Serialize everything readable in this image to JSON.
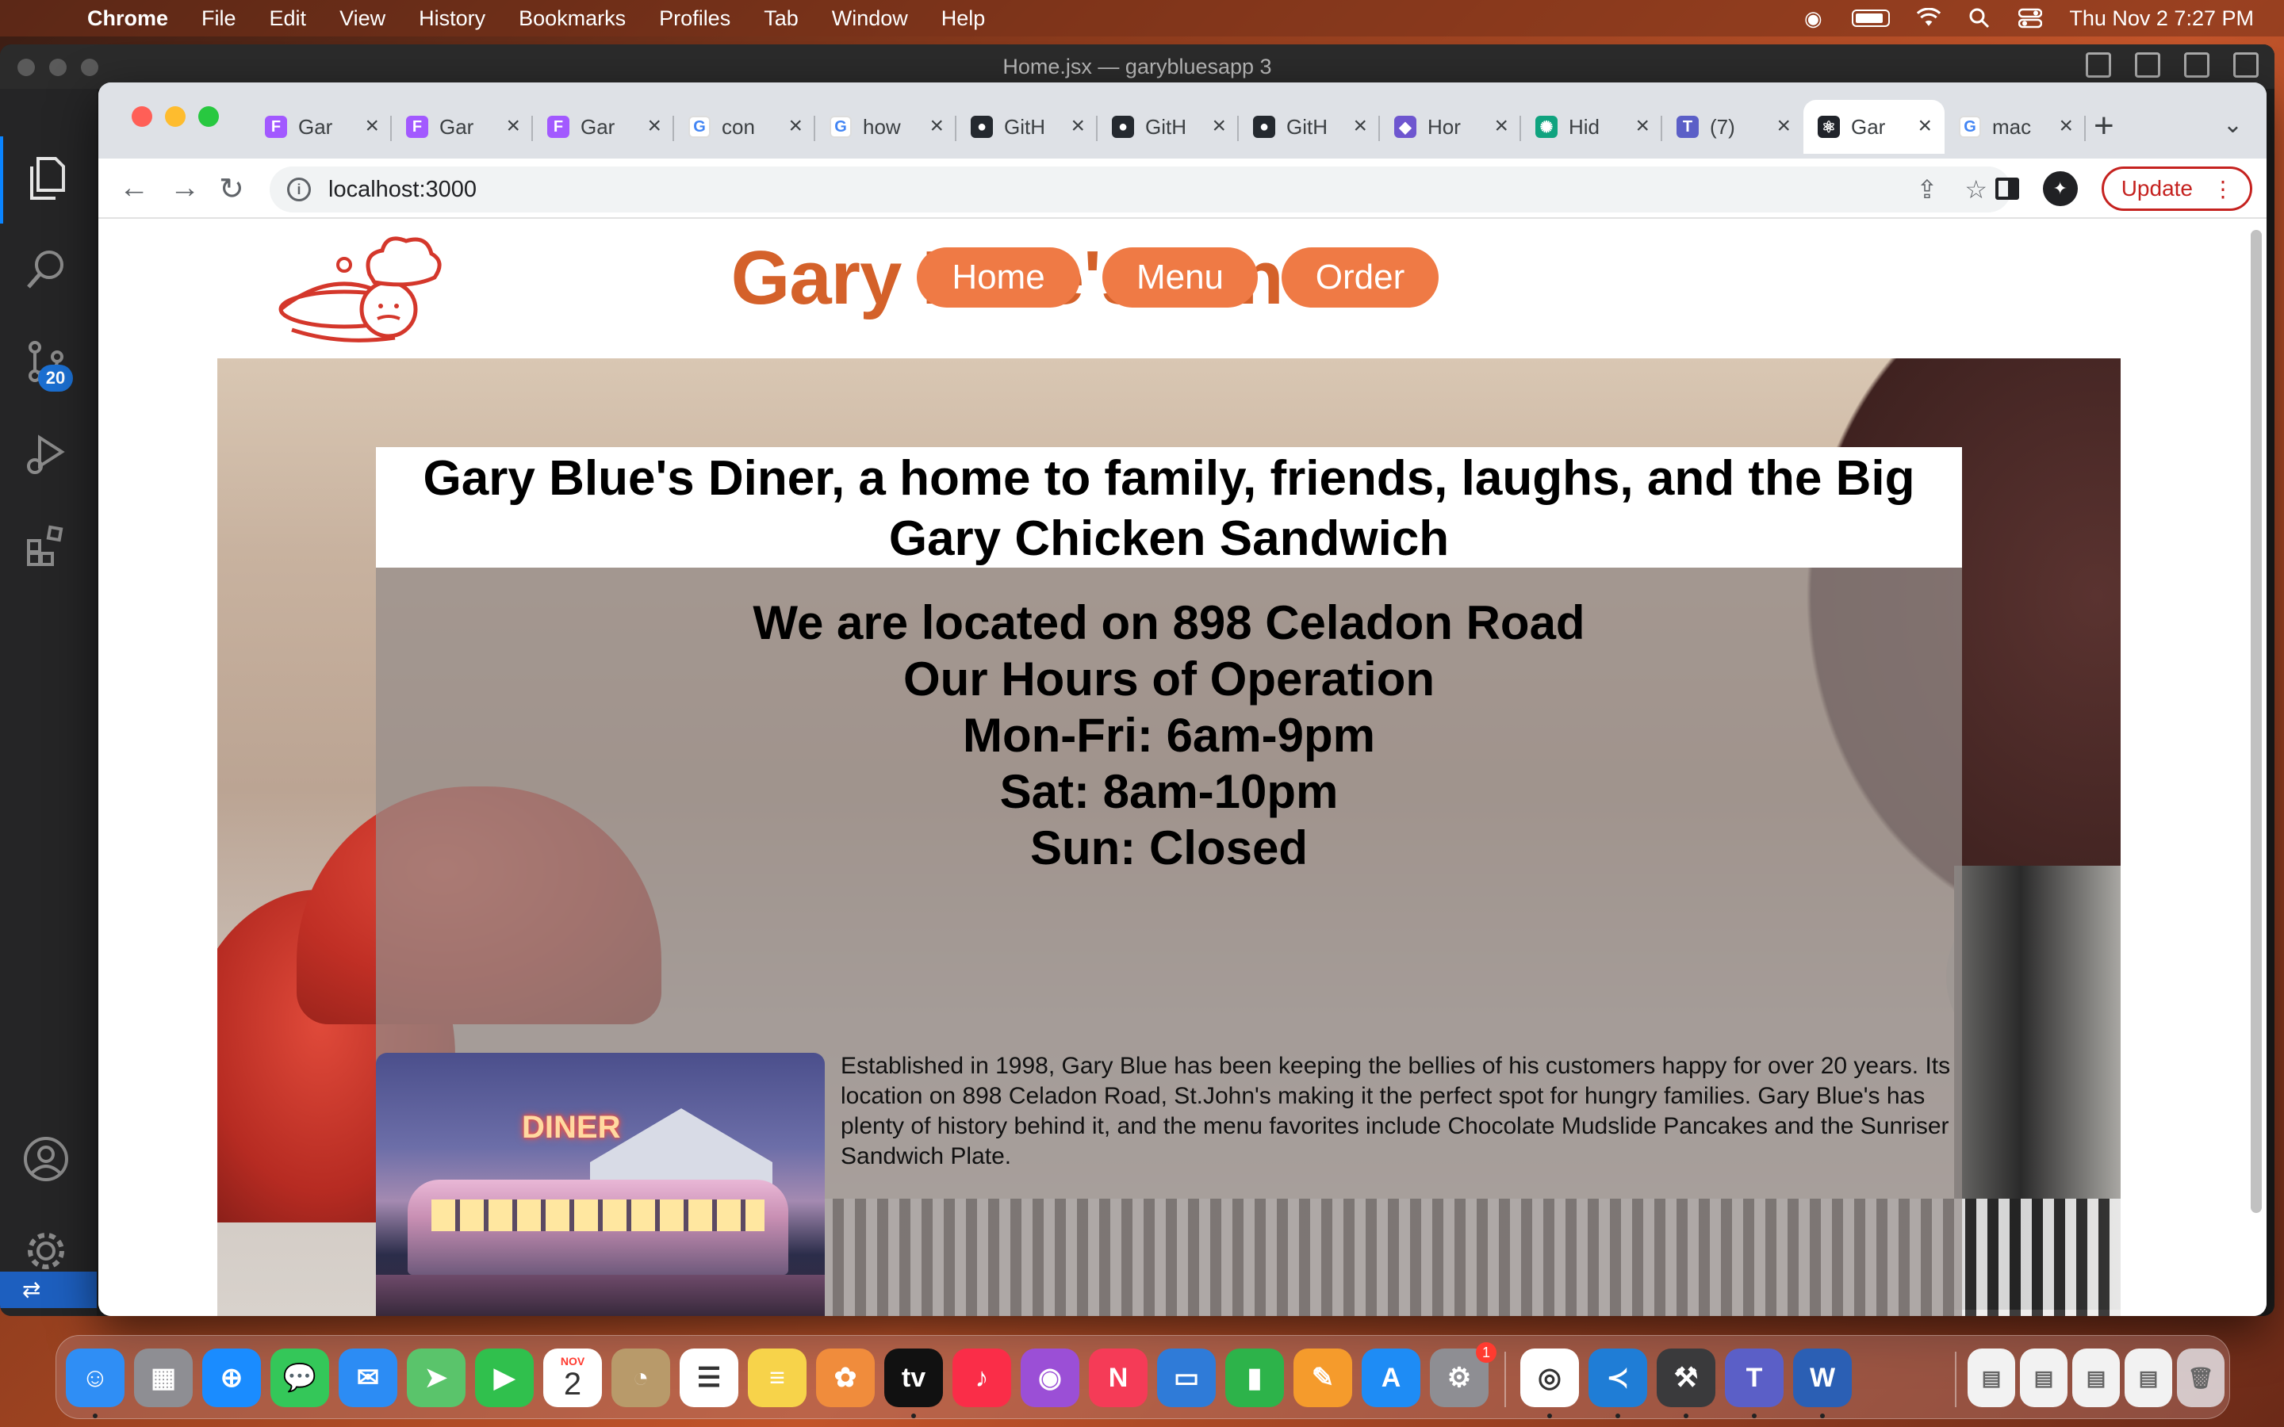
{
  "menubar": {
    "app": "Chrome",
    "items": [
      "File",
      "Edit",
      "View",
      "History",
      "Bookmarks",
      "Profiles",
      "Tab",
      "Window",
      "Help"
    ],
    "clock": "Thu Nov 2  7:27 PM"
  },
  "vscode": {
    "title": "Home.jsx — garybluesapp 3",
    "scm_badge": "20"
  },
  "chrome": {
    "tabs": [
      {
        "title": "Gar",
        "favicon": "figma-icon",
        "color": "#a259ff"
      },
      {
        "title": "Gar",
        "favicon": "figma-icon",
        "color": "#a259ff"
      },
      {
        "title": "Gar",
        "favicon": "figma-icon",
        "color": "#a259ff"
      },
      {
        "title": "con",
        "favicon": "google-icon",
        "color": "#4285f4"
      },
      {
        "title": "how",
        "favicon": "google-icon",
        "color": "#4285f4"
      },
      {
        "title": "GitH",
        "favicon": "github-icon",
        "color": "#24292f"
      },
      {
        "title": "GitH",
        "favicon": "github-icon",
        "color": "#24292f"
      },
      {
        "title": "GitH",
        "favicon": "github-icon",
        "color": "#24292f"
      },
      {
        "title": "Hor",
        "favicon": "copilot-icon",
        "color": "#6e56cf"
      },
      {
        "title": "Hid",
        "favicon": "chatgpt-icon",
        "color": "#10a37f"
      },
      {
        "title": "(7)",
        "favicon": "teams-icon",
        "color": "#5b5fc7"
      },
      {
        "title": "Gar",
        "favicon": "react-icon",
        "color": "#20232a",
        "active": true
      },
      {
        "title": "mac",
        "favicon": "google-icon",
        "color": "#4285f4"
      }
    ],
    "url": "localhost:3000",
    "update_label": "Update"
  },
  "site": {
    "title": "Gary Blue's Diner",
    "nav": [
      "Home",
      "Menu",
      "Order"
    ],
    "tagline": "Gary Blue's Diner, a home to family, friends, laughs, and the Big Gary Chicken Sandwich",
    "location": "We are located on 898 Celadon Road",
    "hours_heading": "Our Hours of Operation",
    "hours": [
      "Mon-Fri: 6am-9pm",
      "Sat: 8am-10pm",
      "Sun: Closed"
    ],
    "photo_sign": "DINER",
    "about": "Established in 1998, Gary Blue has been keeping the bellies of his customers happy for over 20 years. Its location on 898 Celadon Road, St.John's making it the perfect spot for hungry families. Gary Blue's has plenty of history behind it, and the menu favorites include Chocolate Mudslide Pancakes and the Sunriser Sandwich Plate."
  },
  "dock": {
    "calendar_month": "NOV",
    "calendar_day": "2",
    "settings_badge": "1",
    "apps": [
      {
        "name": "finder-icon",
        "color": "#2f8ef5"
      },
      {
        "name": "launchpad-icon",
        "color": "#8e8e93"
      },
      {
        "name": "safari-icon",
        "color": "#1a8cff"
      },
      {
        "name": "messages-icon",
        "color": "#34c759"
      },
      {
        "name": "mail-icon",
        "color": "#2c8cf4"
      },
      {
        "name": "maps-icon",
        "color": "#5ac46b"
      },
      {
        "name": "facetime-icon",
        "color": "#30c04d"
      },
      {
        "name": "calendar-icon",
        "color": "#ffffff"
      },
      {
        "name": "contacts-icon",
        "color": "#b89a6a"
      },
      {
        "name": "reminders-icon",
        "color": "#ffffff"
      },
      {
        "name": "notes-icon",
        "color": "#f7d34a"
      },
      {
        "name": "photos-icon",
        "color": "#f08c3c"
      },
      {
        "name": "tv-icon",
        "color": "#111111"
      },
      {
        "name": "music-icon",
        "color": "#fa2d48"
      },
      {
        "name": "podcasts-icon",
        "color": "#9b4fd6"
      },
      {
        "name": "news-icon",
        "color": "#f53b57"
      },
      {
        "name": "keynote-icon",
        "color": "#2f7bd8"
      },
      {
        "name": "numbers-icon",
        "color": "#2db34a"
      },
      {
        "name": "pages-icon",
        "color": "#f59b2c"
      },
      {
        "name": "appstore-icon",
        "color": "#1e8cf5"
      },
      {
        "name": "system-settings-icon",
        "color": "#8e8e93"
      },
      {
        "name": "chrome-icon",
        "color": "#ffffff"
      },
      {
        "name": "vscode-icon",
        "color": "#1f7dd6"
      },
      {
        "name": "xcode-icon",
        "color": "#3a3a3c"
      },
      {
        "name": "teams-icon",
        "color": "#5b5fc7"
      },
      {
        "name": "word-icon",
        "color": "#2b5fb4"
      }
    ]
  }
}
